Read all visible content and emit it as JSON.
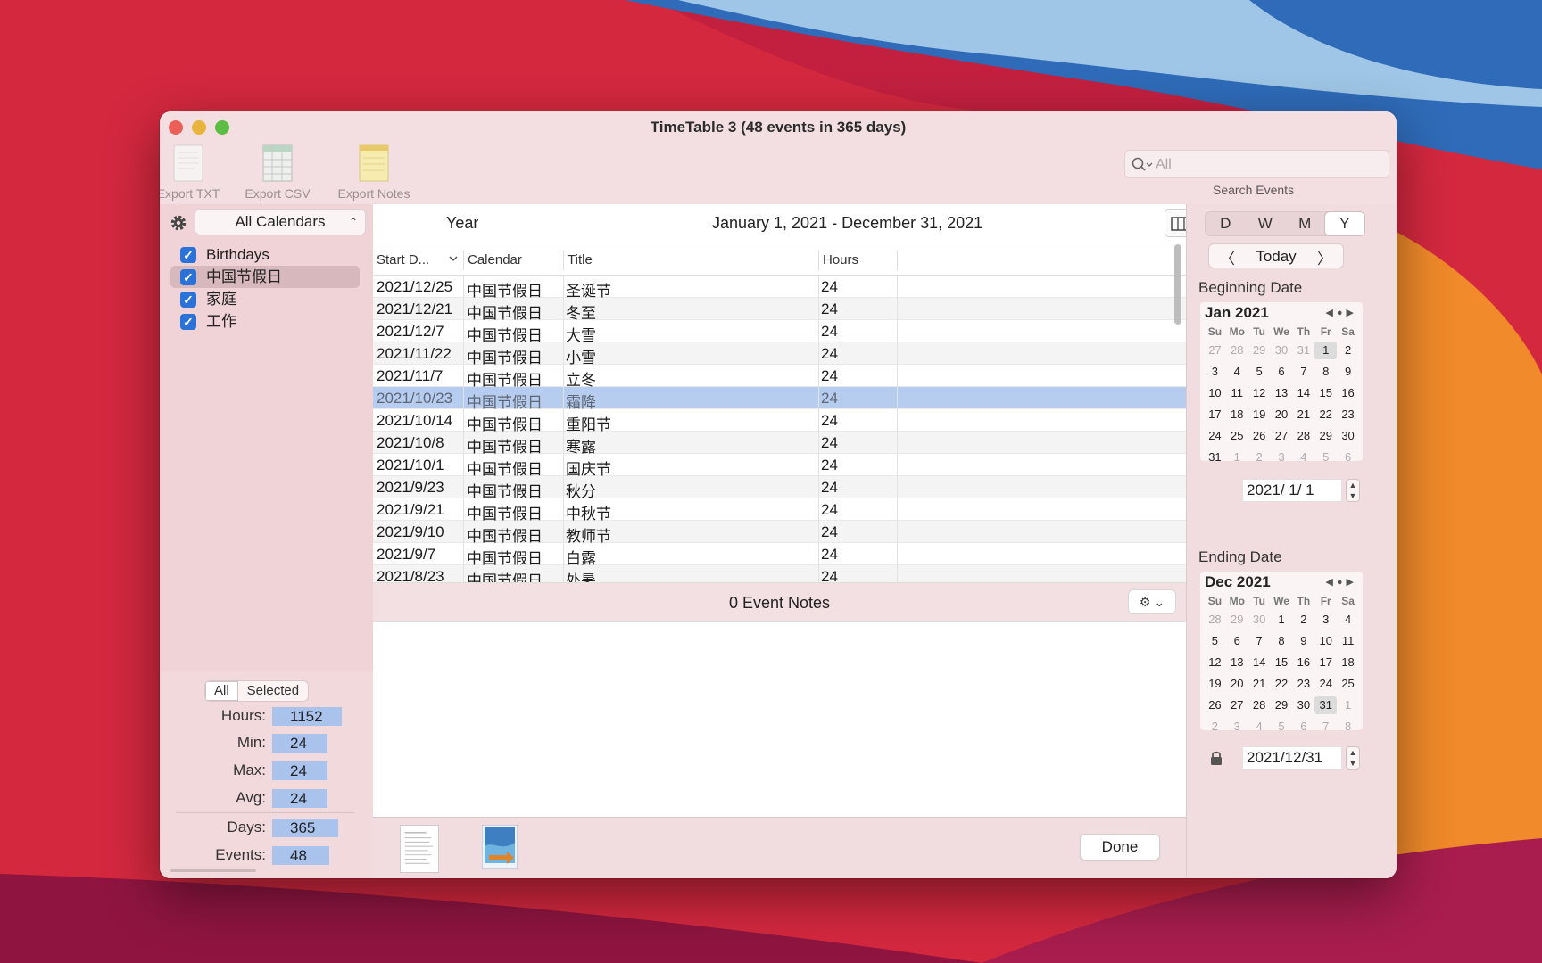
{
  "window": {
    "title": "TimeTable 3 (48 events in 365 days)"
  },
  "toolbar": {
    "export_txt": "Export TXT",
    "export_csv": "Export CSV",
    "export_notes": "Export Notes"
  },
  "search": {
    "placeholder": "All",
    "label": "Search Events"
  },
  "sidebar": {
    "calendar_select": "All Calendars",
    "calendars": [
      {
        "label": "Birthdays",
        "checked": true
      },
      {
        "label": "中国节假日",
        "checked": true,
        "selected": true
      },
      {
        "label": "家庭",
        "checked": true
      },
      {
        "label": "工作",
        "checked": true
      }
    ],
    "stats_tabs": [
      "All",
      "Selected"
    ],
    "stats": {
      "hours_label": "Hours:",
      "hours": "1152",
      "min_label": "Min:",
      "min": "24",
      "max_label": "Max:",
      "max": "24",
      "avg_label": "Avg:",
      "avg": "24",
      "days_label": "Days:",
      "days": "365",
      "events_label": "Events:",
      "events": "48"
    }
  },
  "main": {
    "period": "Year",
    "range": "January 1, 2021 - December 31, 2021",
    "columns": [
      "Start D...",
      "Calendar",
      "Title",
      "Hours"
    ],
    "rows": [
      {
        "start": "2021/12/25",
        "calendar": "中国节假日",
        "title": "圣诞节",
        "hours": "24"
      },
      {
        "start": "2021/12/21",
        "calendar": "中国节假日",
        "title": "冬至",
        "hours": "24"
      },
      {
        "start": "2021/12/7",
        "calendar": "中国节假日",
        "title": "大雪",
        "hours": "24"
      },
      {
        "start": "2021/11/22",
        "calendar": "中国节假日",
        "title": "小雪",
        "hours": "24"
      },
      {
        "start": "2021/11/7",
        "calendar": "中国节假日",
        "title": "立冬",
        "hours": "24"
      },
      {
        "start": "2021/10/23",
        "calendar": "中国节假日",
        "title": "霜降",
        "hours": "24"
      },
      {
        "start": "2021/10/14",
        "calendar": "中国节假日",
        "title": "重阳节",
        "hours": "24"
      },
      {
        "start": "2021/10/8",
        "calendar": "中国节假日",
        "title": "寒露",
        "hours": "24"
      },
      {
        "start": "2021/10/1",
        "calendar": "中国节假日",
        "title": "国庆节",
        "hours": "24"
      },
      {
        "start": "2021/9/23",
        "calendar": "中国节假日",
        "title": "秋分",
        "hours": "24"
      },
      {
        "start": "2021/9/21",
        "calendar": "中国节假日",
        "title": "中秋节",
        "hours": "24"
      },
      {
        "start": "2021/9/10",
        "calendar": "中国节假日",
        "title": "教师节",
        "hours": "24"
      },
      {
        "start": "2021/9/7",
        "calendar": "中国节假日",
        "title": "白露",
        "hours": "24"
      },
      {
        "start": "2021/8/23",
        "calendar": "中国节假日",
        "title": "处暑",
        "hours": "24"
      }
    ],
    "selected_row": 5,
    "notes_label": "0 Event Notes",
    "done": "Done"
  },
  "right": {
    "view_modes": [
      "D",
      "W",
      "M",
      "Y"
    ],
    "active_mode": "Y",
    "today": "Today",
    "beginning_label": "Beginning Date",
    "beginning_month": "Jan 2021",
    "beginning_field": "2021/  1/   1",
    "ending_label": "Ending Date",
    "ending_month": "Dec 2021",
    "ending_field": "2021/12/31",
    "weekdays": [
      "Su",
      "Mo",
      "Tu",
      "We",
      "Th",
      "Fr",
      "Sa"
    ],
    "jan_days": [
      "27",
      "28",
      "29",
      "30",
      "31",
      "1",
      "2",
      "3",
      "4",
      "5",
      "6",
      "7",
      "8",
      "9",
      "10",
      "11",
      "12",
      "13",
      "14",
      "15",
      "16",
      "17",
      "18",
      "19",
      "20",
      "21",
      "22",
      "23",
      "24",
      "25",
      "26",
      "27",
      "28",
      "29",
      "30",
      "31",
      "1",
      "2",
      "3",
      "4",
      "5",
      "6"
    ],
    "dec_days": [
      "28",
      "29",
      "30",
      "1",
      "2",
      "3",
      "4",
      "5",
      "6",
      "7",
      "8",
      "9",
      "10",
      "11",
      "12",
      "13",
      "14",
      "15",
      "16",
      "17",
      "18",
      "19",
      "20",
      "21",
      "22",
      "23",
      "24",
      "25",
      "26",
      "27",
      "28",
      "29",
      "30",
      "31",
      "1",
      "2",
      "3",
      "4",
      "5",
      "6",
      "7",
      "8"
    ]
  },
  "colors": {
    "selection": "#b7cdf0",
    "stat_value": "#aac3ec",
    "checkbox": "#2a72d8",
    "window_bg": "#f3dfe2"
  }
}
